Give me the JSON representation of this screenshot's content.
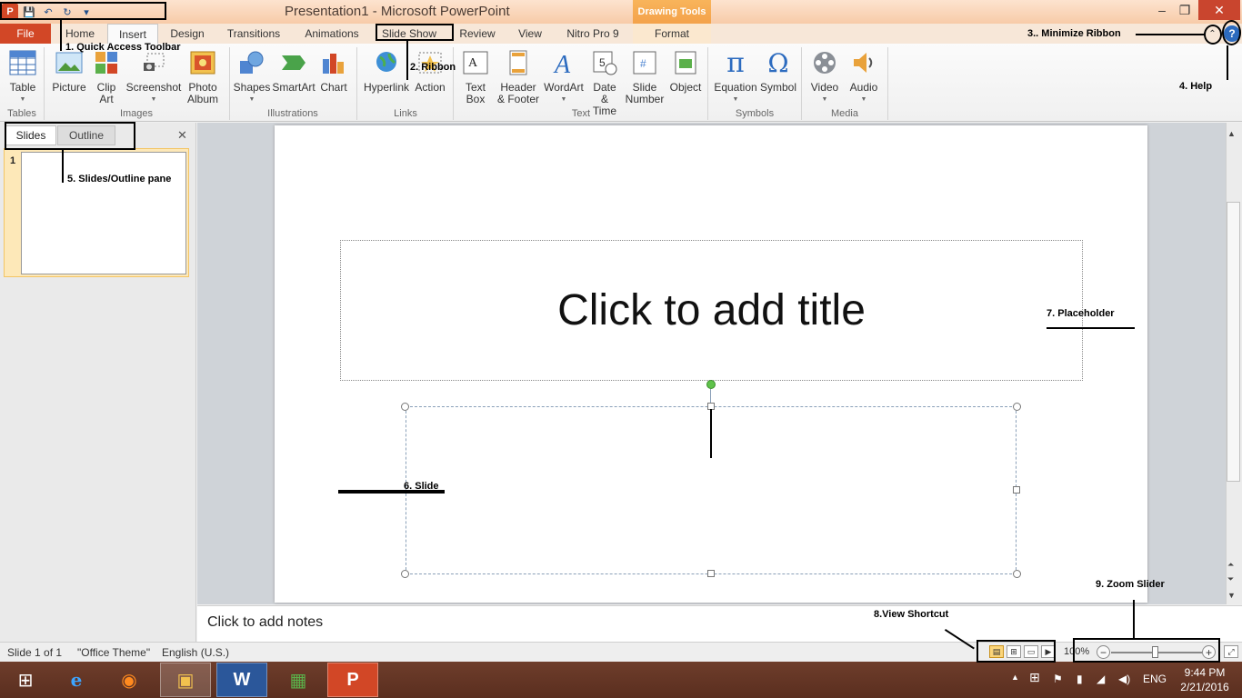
{
  "window": {
    "title": "Presentation1 - Microsoft PowerPoint",
    "context_tab_group": "Drawing Tools",
    "minimize": "–",
    "restore": "❐",
    "close": "✕"
  },
  "qat": {
    "app_icon": "P",
    "save_icon": "💾",
    "undo_icon": "↶",
    "redo_icon": "↻",
    "more_icon": "▾"
  },
  "tabs": [
    "File",
    "Home",
    "Insert",
    "Design",
    "Transitions",
    "Animations",
    "Slide Show",
    "Review",
    "View",
    "Nitro Pro 9",
    "Format"
  ],
  "ribbon": {
    "groups": [
      "Tables",
      "Images",
      "Illustrations",
      "Links",
      "Text",
      "Symbols",
      "Media"
    ],
    "buttons": {
      "table": "Table",
      "picture": "Picture",
      "clip_art": "Clip Art",
      "screenshot": "Screenshot",
      "photo_album": "Photo Album",
      "shapes": "Shapes",
      "smartart": "SmartArt",
      "chart": "Chart",
      "hyperlink": "Hyperlink",
      "action": "Action",
      "text_box": "Text Box",
      "header_footer": "Header & Footer",
      "wordart": "WordArt",
      "date_time": "Date & Time",
      "slide_number": "Slide Number",
      "object": "Object",
      "equation": "Equation",
      "symbol": "Symbol",
      "video": "Video",
      "audio": "Audio"
    }
  },
  "left_pane": {
    "tab_slides": "Slides",
    "tab_outline": "Outline",
    "close": "✕",
    "thumbnail_number": "1"
  },
  "slide": {
    "title_placeholder": "Click to add title"
  },
  "notes": {
    "placeholder": "Click to add notes"
  },
  "status": {
    "slide_info": "Slide 1 of 1",
    "theme": "\"Office Theme\"",
    "language": "English (U.S.)",
    "zoom": "100%",
    "zoom_level_percent": 100
  },
  "taskbar": {
    "time": "9:44 PM",
    "date": "2/21/2016",
    "lang": "ENG"
  },
  "annotations": {
    "qat": "1. Quick Access Toolbar",
    "ribbon": "2. Ribbon",
    "minimize_ribbon": "3.. Minimize Ribbon",
    "help": "4. Help",
    "slides_outline": "5. Slides/Outline pane",
    "slide": "6. Slide",
    "placeholder": "7. Placeholder",
    "view_shortcut": "8.View  Shortcut",
    "zoom_slider": "9. Zoom Slider"
  }
}
